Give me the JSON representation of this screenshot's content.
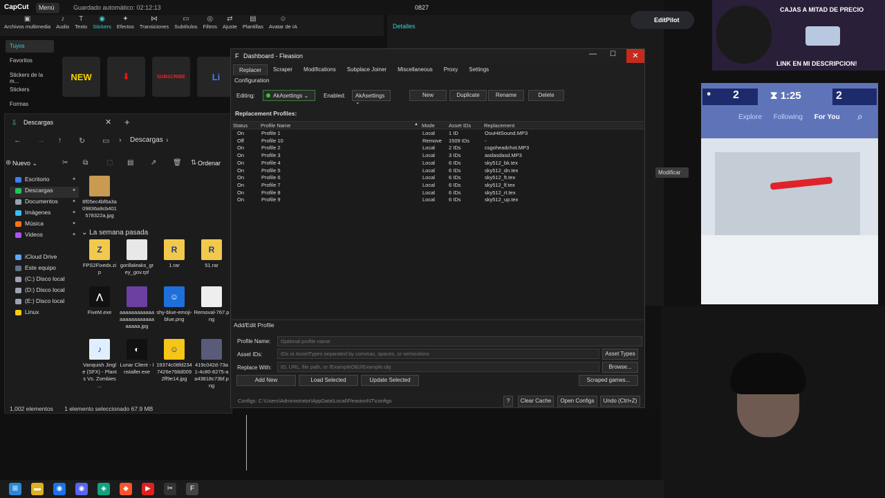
{
  "capcut": {
    "logo": "CapCut",
    "menu": "Menú",
    "autosave": "Guardado automático: 02:12:13",
    "project_name": "0827",
    "tools": [
      {
        "icon": "▣",
        "label": "Archivos multimedia"
      },
      {
        "icon": "♪",
        "label": "Audio"
      },
      {
        "icon": "T",
        "label": "Texto"
      },
      {
        "icon": "◉",
        "label": "Stickers"
      },
      {
        "icon": "✦",
        "label": "Efectos"
      },
      {
        "icon": "⋈",
        "label": "Transiciones"
      },
      {
        "icon": "▭",
        "label": "Subtítulos"
      },
      {
        "icon": "◎",
        "label": "Filtros"
      },
      {
        "icon": "⇄",
        "label": "Ajuste"
      },
      {
        "icon": "▤",
        "label": "Plantillas"
      },
      {
        "icon": "☺",
        "label": "Avatar de IA"
      }
    ],
    "active_tool": "Stickers",
    "side_items": [
      "Tuyos",
      "Favoritos",
      "Stickers de la m...",
      "Stickers",
      "Formas"
    ],
    "stickers": [
      "NEW",
      "⬇",
      "SUBSCRIBE",
      "Li"
    ],
    "details_title": "Detalles",
    "modify_button": "Modificar",
    "editpilot": "EditPilot"
  },
  "explorer": {
    "tab_title": "Descargas",
    "path": "Descargas",
    "new_button": "Nuevo",
    "sort_button": "Ordenar",
    "nav_pane": [
      {
        "label": "Escritorio",
        "pinned": true,
        "color": "#3b82f6"
      },
      {
        "label": "Descargas",
        "pinned": true,
        "color": "#22c55e",
        "selected": true
      },
      {
        "label": "Documentos",
        "pinned": true,
        "color": "#94a3b8"
      },
      {
        "label": "Imágenes",
        "pinned": true,
        "color": "#38bdf8"
      },
      {
        "label": "Música",
        "pinned": true,
        "color": "#f97316"
      },
      {
        "label": "Videos",
        "pinned": true,
        "color": "#a855f7"
      },
      {
        "label": "",
        "pinned": false
      },
      {
        "label": "iCloud Drive",
        "pinned": false,
        "color": "#60a5fa"
      },
      {
        "label": "Este equipo",
        "pinned": false,
        "color": "#64748b"
      },
      {
        "label": "(C:) Disco local",
        "pinned": false,
        "color": "#9ca3af"
      },
      {
        "label": "(D:) Disco local",
        "pinned": false,
        "color": "#9ca3af"
      },
      {
        "label": "(E:) Disco local",
        "pinned": false,
        "color": "#9ca3af"
      },
      {
        "label": "Linux",
        "pinned": false,
        "color": "#facc15"
      }
    ],
    "top_file": {
      "name": "8f05ec4bf6a3a09836a9cb401578322a.jpg",
      "color": "#c89a52"
    },
    "section_label": "La semana pasada",
    "files_row1": [
      {
        "name": "FPS2Fixedx.zip",
        "thumb": "Z",
        "color": "#f2c94c"
      },
      {
        "name": "gorillaleaks_grey_gov.rpf",
        "thumb": "",
        "color": "#e8e8e8"
      },
      {
        "name": "1.rar",
        "thumb": "R",
        "color": "#f2c94c"
      },
      {
        "name": "51.rar",
        "thumb": "R",
        "color": "#f2c94c"
      }
    ],
    "files_row2": [
      {
        "name": "FiveM.exe",
        "thumb": "⋀",
        "color": "#111"
      },
      {
        "name": "aaaaaaaaaaaaaaaaaaaaaaaaaaaaa.jpg",
        "thumb": "",
        "color": "#6b3fa0"
      },
      {
        "name": "shy-blue-emoji-blue.png",
        "thumb": "☺",
        "color": "#1e6fd9"
      },
      {
        "name": "Removal-767.png",
        "thumb": "",
        "color": "#eeeeee"
      }
    ],
    "files_row3": [
      {
        "name": "Vanquish Jingle (SFX) - Plants Vs. Zombies ...",
        "thumb": "♪",
        "color": "#dfefff"
      },
      {
        "name": "Lunar Client - Installer.exe",
        "thumb": "◐",
        "color": "#111"
      },
      {
        "name": "19374c08fd2347426e768d0092ff9e14.jpg",
        "thumb": "☺",
        "color": "#f5c518"
      },
      {
        "name": "419c042d-73a1-4c80-8275-aa43818c73bf.png",
        "thumb": "",
        "color": "#5a5a7a"
      }
    ],
    "status": [
      "1,002 elementos",
      "1 elemento seleccionado 67.9 MB"
    ]
  },
  "fleasion": {
    "title": "Dashboard - Fleasion",
    "tabs": [
      "Replacer",
      "Scraper",
      "Modifications",
      "Subplace Joiner",
      "Miscellaneous",
      "Proxy",
      "Settings"
    ],
    "active_tab": "Replacer",
    "config_title": "Configuration",
    "editing_label": "Editing:",
    "editing_value": "AkAsettings",
    "enabled_label": "Enabled:",
    "enabled_value": "AkAsettings",
    "buttons": {
      "new": "New",
      "duplicate": "Duplicate",
      "rename": "Rename",
      "delete": "Delete"
    },
    "replacement_label": "Replacement Profiles:",
    "columns": [
      "Status",
      "Profile Name",
      "Mode",
      "Asset IDs",
      "Replacement"
    ],
    "profiles": [
      {
        "status": "On",
        "name": "Profile 1",
        "mode": "Local",
        "ids": "1 ID",
        "replacement": "OsuHitSound.MP3"
      },
      {
        "status": "Off",
        "name": "Profile 10",
        "mode": "Remove",
        "ids": "1509 IDs",
        "replacement": "-"
      },
      {
        "status": "On",
        "name": "Profile 2",
        "mode": "Local",
        "ids": "2 IDs",
        "replacement": "csgoheadchot.MP3"
      },
      {
        "status": "On",
        "name": "Profile 3",
        "mode": "Local",
        "ids": "3 IDs",
        "replacement": "asdasdasd.MP3"
      },
      {
        "status": "On",
        "name": "Profile 4",
        "mode": "Local",
        "ids": "6 IDs",
        "replacement": "sky512_bk.tex"
      },
      {
        "status": "On",
        "name": "Profile 5",
        "mode": "Local",
        "ids": "6 IDs",
        "replacement": "sky512_dn.tex"
      },
      {
        "status": "On",
        "name": "Profile 6",
        "mode": "Local",
        "ids": "6 IDs",
        "replacement": "sky512_ft.tex"
      },
      {
        "status": "On",
        "name": "Profile 7",
        "mode": "Local",
        "ids": "6 IDs",
        "replacement": "sky512_lf.tex"
      },
      {
        "status": "On",
        "name": "Profile 8",
        "mode": "Local",
        "ids": "6 IDs",
        "replacement": "sky512_rt.tex"
      },
      {
        "status": "On",
        "name": "Profile 9",
        "mode": "Local",
        "ids": "6 IDs",
        "replacement": "sky512_up.tex"
      }
    ],
    "edit_title": "Add/Edit Profile",
    "profile_name_label": "Profile Name:",
    "profile_name_placeholder": "Optional profile name",
    "asset_ids_label": "Asset IDs:",
    "asset_ids_placeholder": "IDs or AssetTypes separated by commas, spaces, or semicolons",
    "asset_types_button": "Asset Types",
    "replace_with_label": "Replace With:",
    "replace_with_placeholder": "ID, URL, file path, or /ExampleOBJ/Example.obj",
    "browse_button": "Browse...",
    "add_new_button": "Add New",
    "load_selected_button": "Load Selected",
    "update_selected_button": "Update Selected",
    "scraped_games_button": "Scraped games...",
    "configs_path": "Configs: C:\\Users\\Administrator\\AppData\\Local\\FleasionNT\\configs",
    "help_button": "?",
    "clear_cache_button": "Clear Cache",
    "open_configs_button": "Open Configs",
    "undo_button": "Undo (Ctrl+Z)"
  },
  "overlay": {
    "promo_top": "CAJAS A MITAD DE PRECIO",
    "promo_bottom": "LINK EN MI DESCRIPCION!",
    "game_team_left": "2",
    "game_timer": "1:25",
    "game_team_right": "2",
    "game_nav": [
      "Explore",
      "Following",
      "For You"
    ]
  },
  "taskbar": [
    {
      "icon": "⊞",
      "color": "#2b88d8"
    },
    {
      "icon": "▬",
      "color": "#e0b020"
    },
    {
      "icon": "◉",
      "color": "#1a73e8"
    },
    {
      "icon": "◉",
      "color": "#5865f2"
    },
    {
      "icon": "◈",
      "color": "#10a37f"
    },
    {
      "icon": "◆",
      "color": "#fb542b"
    },
    {
      "icon": "▶",
      "color": "#e02020"
    },
    {
      "icon": "✂",
      "color": "#333"
    },
    {
      "icon": "F",
      "color": "#444"
    }
  ]
}
